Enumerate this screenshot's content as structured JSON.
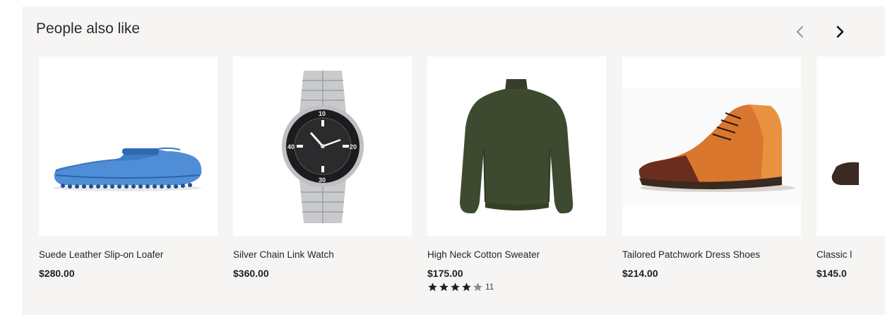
{
  "section": {
    "title": "People also like",
    "prev_icon": "chevron-left-icon",
    "next_icon": "chevron-right-icon"
  },
  "products": [
    {
      "name": "Suede Leather Slip-on Loafer",
      "price": "$280.00",
      "image": "blue-loafer"
    },
    {
      "name": "Silver Chain Link Watch",
      "price": "$360.00",
      "image": "silver-watch"
    },
    {
      "name": "High Neck Cotton Sweater",
      "price": "$175.00",
      "image": "green-sweater",
      "rating": {
        "stars": 4,
        "max": 5,
        "count": "11"
      }
    },
    {
      "name": "Tailored Patchwork Dress Shoes",
      "price": "$214.00",
      "image": "brown-boot"
    },
    {
      "name": "Classic l",
      "price": "$145.0",
      "image": "dark-shoe"
    }
  ],
  "colors": {
    "panel_bg": "#f6f5f4",
    "star_filled": "#1f1f1f",
    "star_empty": "#8a8a8a"
  }
}
